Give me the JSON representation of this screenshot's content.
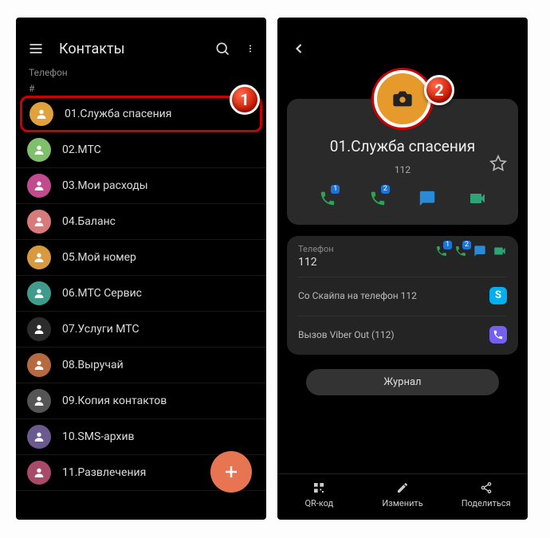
{
  "markers": {
    "one": "1",
    "two": "2"
  },
  "left": {
    "title": "Контакты",
    "phone_label": "Телефон",
    "section": "#",
    "contacts": [
      {
        "label": "01.Служба спасения",
        "color": "#e0a23c",
        "selected": true
      },
      {
        "label": "02.МТС",
        "color": "#7fbf6b"
      },
      {
        "label": "03.Мои расходы",
        "color": "#c24b8f"
      },
      {
        "label": "04.Баланс",
        "color": "#d77a7a"
      },
      {
        "label": "05.Мой номер",
        "color": "#d99a3f"
      },
      {
        "label": "06.МТС Сервис",
        "color": "#3f9c8c"
      },
      {
        "label": "07.Услуги МТС",
        "color": "#2c2c2c"
      },
      {
        "label": "08.Выручай",
        "color": "#b56b3f"
      },
      {
        "label": "09.Копия контактов",
        "color": "#555"
      },
      {
        "label": "10.SMS-архив",
        "color": "#6b5a8f"
      },
      {
        "label": "11.Развлечения",
        "color": "#a84b6b"
      }
    ]
  },
  "right": {
    "name": "01.Служба спасения",
    "number": "112",
    "phone_section_label": "Телефон",
    "phone_section_value": "112",
    "skype_line": "Со Скайпа на телефон 112",
    "viber_line": "Вызов Viber Out (112)",
    "journal": "Журнал",
    "bottom": {
      "qr": "QR-код",
      "edit": "Изменить",
      "share": "Поделиться"
    },
    "badges": {
      "sim1": "1",
      "sim2": "2"
    }
  }
}
